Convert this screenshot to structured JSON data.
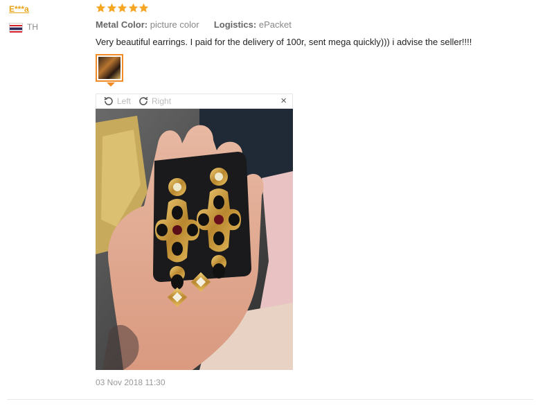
{
  "user": {
    "name": "E***a",
    "country_code": "TH"
  },
  "review": {
    "rating": 5,
    "attributes": [
      {
        "label": "Metal Color:",
        "value": "picture color"
      },
      {
        "label": "Logistics:",
        "value": "ePacket"
      }
    ],
    "text": "Very beautiful earrings. I paid for the delivery of 100r, sent mega quickly))) i advise the seller!!!!",
    "date": "03 Nov 2018 11:30"
  },
  "viewer": {
    "rotate_left_label": "Left",
    "rotate_right_label": "Right",
    "close_glyph": "×",
    "icons": [
      "rotate-left-icon",
      "rotate-right-icon",
      "close-icon"
    ]
  },
  "colors": {
    "star": "#f5a623",
    "username": "#e8a317",
    "thumb_border": "#f08a24"
  }
}
